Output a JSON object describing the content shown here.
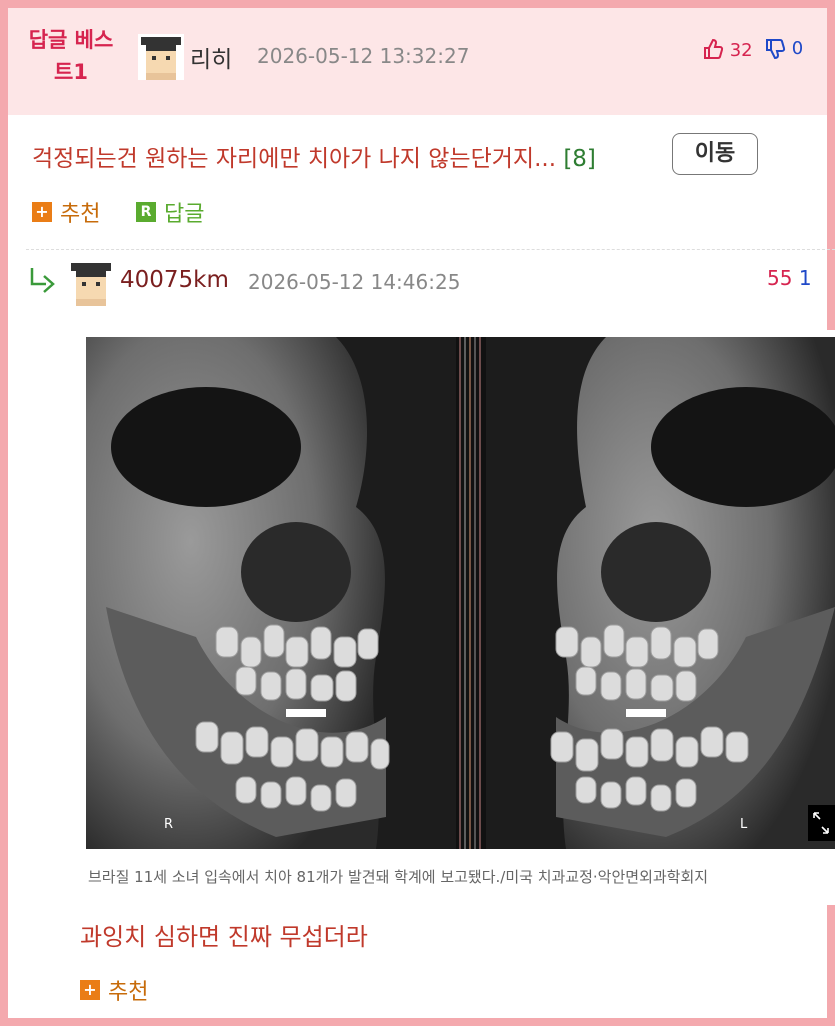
{
  "best_reply": {
    "label": "답글 베스트1",
    "username": "리히",
    "datetime": "2026-05-12 13:32:27",
    "likes": "32",
    "dislikes": "0",
    "text": "걱정되는건 원하는 자리에만 치아가 나지 않는단거지...",
    "reply_count": "[8]",
    "move_button": "이동",
    "recommend_label": "추천",
    "reply_label": "답글"
  },
  "reply": {
    "username": "40075km",
    "datetime": "2026-05-12 14:46:25",
    "likes": "55",
    "dislikes": "1",
    "image": {
      "left_label": "R",
      "right_label": "L",
      "caption": "브라질 11세 소녀 입속에서 치아 81개가 발견돼 학계에 보고됐다./미국 치과교정·악안면외과학회지"
    },
    "text": "과잉치 심하면 진짜 무섭더라",
    "recommend_label": "추천"
  },
  "colors": {
    "frame": "#f4a9ae",
    "header_bg": "#fde6e7",
    "best_label": "#d6244f",
    "comment_text": "#c0392b",
    "like": "#d6244f",
    "dislike": "#1f49c8",
    "reply_count": "#2e7d32"
  },
  "icons": [
    "thumbs-up-icon",
    "thumbs-down-icon",
    "plus-icon",
    "reply-icon",
    "reply-arrow-icon",
    "expand-icon"
  ]
}
